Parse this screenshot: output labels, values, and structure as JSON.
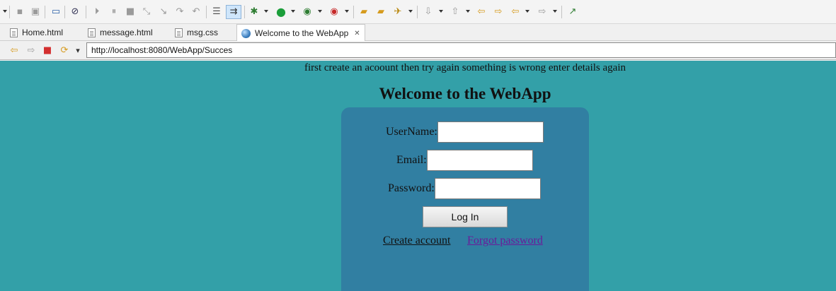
{
  "window": {
    "title": "Welcome to the WebApp"
  },
  "toolbar": {
    "items": [
      {
        "name": "save-icon",
        "glyph": "▪",
        "dim": true
      },
      {
        "name": "save-all-icon",
        "glyph": "▣",
        "dim": true
      },
      {
        "name": "display-icon",
        "glyph": "▭",
        "dim": false
      },
      {
        "name": "skip-breakpoints-icon",
        "glyph": "⊘",
        "dim": false
      },
      {
        "name": "resume-icon",
        "glyph": "⏵",
        "dim": true
      },
      {
        "name": "suspend-icon",
        "glyph": "⏸",
        "dim": true
      },
      {
        "name": "terminate-icon",
        "glyph": "■",
        "dim": true
      },
      {
        "name": "disconnect-icon",
        "glyph": "⤡",
        "dim": true
      },
      {
        "name": "step-into-icon",
        "glyph": "↘",
        "dim": true
      },
      {
        "name": "step-over-icon",
        "glyph": "↷",
        "dim": true
      },
      {
        "name": "step-return-icon",
        "glyph": "↶",
        "dim": true
      },
      {
        "name": "list-icon",
        "glyph": "☰",
        "dim": false
      },
      {
        "name": "use-step-filters-icon",
        "glyph": "⇉",
        "dim": false,
        "active": true
      },
      {
        "name": "debug-icon",
        "glyph": "✱",
        "dim": false,
        "color": "#2e7d32"
      },
      {
        "name": "run-icon",
        "glyph": "●",
        "dim": false,
        "color": "#1b9e3a"
      },
      {
        "name": "coverage-icon",
        "glyph": "◉",
        "dim": false,
        "color": "#2e7d32"
      },
      {
        "name": "external-tools-icon",
        "glyph": "◉",
        "dim": false,
        "color": "#c62828"
      },
      {
        "name": "open-folder-icon",
        "glyph": "▰",
        "dim": false,
        "color": "#d69b1e"
      },
      {
        "name": "open-type-icon",
        "glyph": "▰",
        "dim": false,
        "color": "#d69b1e"
      },
      {
        "name": "rocket-icon",
        "glyph": "✈",
        "dim": false,
        "color": "#b8860b"
      },
      {
        "name": "next-annotation-icon",
        "glyph": "⇩",
        "dim": true
      },
      {
        "name": "previous-annotation-icon",
        "glyph": "⇧",
        "dim": true
      },
      {
        "name": "last-edit-location-icon",
        "glyph": "⇦",
        "dim": false,
        "color": "#d69b1e"
      },
      {
        "name": "back-icon",
        "glyph": "⇦",
        "dim": false,
        "color": "#d69b1e"
      },
      {
        "name": "forward-history-icon",
        "glyph": "⇨",
        "dim": false,
        "color": "#d69b1e"
      },
      {
        "name": "forward-icon",
        "glyph": "⇨",
        "dim": true
      },
      {
        "name": "new-window-icon",
        "glyph": "↗",
        "dim": false,
        "color": "#2e7d32"
      }
    ]
  },
  "tabs": [
    {
      "label": "Home.html",
      "icon": "file-icon"
    },
    {
      "label": "message.html",
      "icon": "file-icon"
    },
    {
      "label": "msg.css",
      "icon": "file-icon"
    },
    {
      "label": "Welcome to the WebApp",
      "icon": "globe-icon",
      "active": true
    }
  ],
  "tab_close_glyph": "✕",
  "navbar": {
    "back_glyph": "⇦",
    "forward_glyph": "⇨",
    "stop_glyph": "■",
    "refresh_glyph": "⟳",
    "dropdown_glyph": "▾",
    "url": "http://localhost:8080/WebApp/Succes"
  },
  "page": {
    "message": "first create an acoount then try again something is wrong enter details again",
    "title": "Welcome to the WebApp",
    "form": {
      "username_label": "UserName:",
      "username_value": "",
      "email_label": "Email:",
      "email_value": "",
      "password_label": "Password:",
      "password_value": "",
      "login_label": "Log In"
    },
    "links": {
      "create_account": "Create account",
      "forgot_password": "Forgot password"
    }
  },
  "colors": {
    "page_background": "#33a0a8",
    "panel_background": "#317fa2",
    "visited_link": "#6a1b9a"
  }
}
